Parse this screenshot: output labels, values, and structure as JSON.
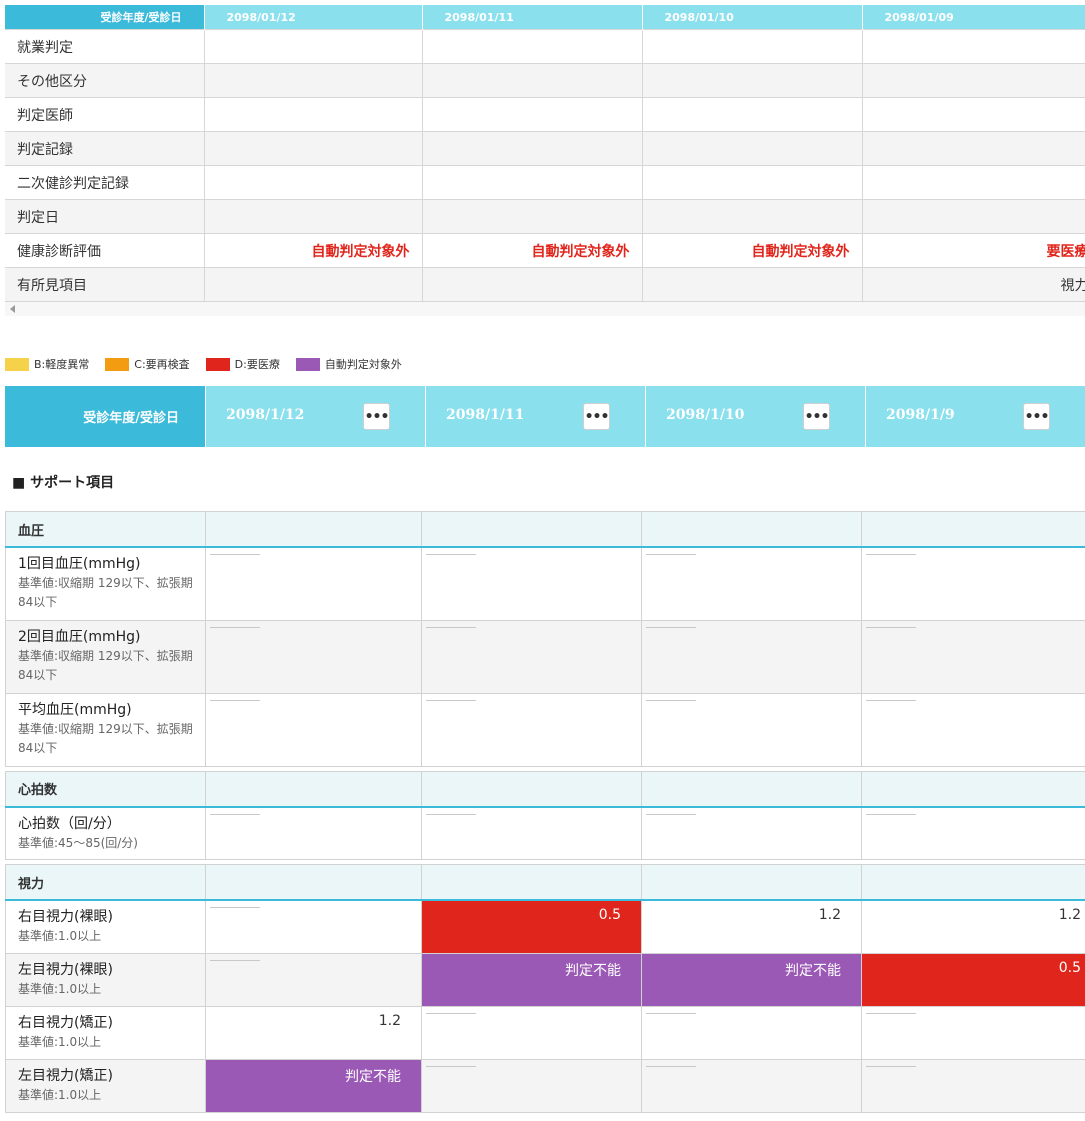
{
  "summary": {
    "header_label": "受診年度/受診日",
    "dates": [
      "2098/01/12",
      "2098/01/11",
      "2098/01/10",
      "2098/01/09"
    ],
    "rows": [
      {
        "label": "就業判定",
        "values": [
          "",
          "",
          "",
          ""
        ]
      },
      {
        "label": "その他区分",
        "values": [
          "",
          "",
          "",
          ""
        ]
      },
      {
        "label": "判定医師",
        "values": [
          "",
          "",
          "",
          ""
        ]
      },
      {
        "label": "判定記録",
        "values": [
          "",
          "",
          "",
          ""
        ]
      },
      {
        "label": "二次健診判定記録",
        "values": [
          "",
          "",
          "",
          ""
        ]
      },
      {
        "label": "判定日",
        "values": [
          "",
          "",
          "",
          ""
        ]
      },
      {
        "label": "健康診断評価",
        "values": [
          "自動判定対象外",
          "自動判定対象外",
          "自動判定対象外",
          "要医療"
        ]
      },
      {
        "label": "有所見項目",
        "values": [
          "",
          "",
          "",
          "視力"
        ]
      }
    ]
  },
  "legend": [
    {
      "label": "B:軽度異常",
      "color": "#f5d24a"
    },
    {
      "label": "C:要再検査",
      "color": "#f39c12"
    },
    {
      "label": "D:要医療",
      "color": "#e0261c"
    },
    {
      "label": "自動判定対象外",
      "color": "#9b59b6"
    }
  ],
  "date_header": {
    "label": "受診年度/受診日",
    "dates": [
      "2098/1/12",
      "2098/1/11",
      "2098/1/10",
      "2098/1/9"
    ],
    "more_label": "•••"
  },
  "section_title": "■ サポート項目",
  "groups": {
    "blood_pressure": {
      "title": "血圧",
      "items": [
        {
          "name": "1回目血圧(mmHg)",
          "ref": "基準値:収縮期 129以下、拡張期 84以下"
        },
        {
          "name": "2回目血圧(mmHg)",
          "ref": "基準値:収縮期 129以下、拡張期 84以下"
        },
        {
          "name": "平均血圧(mmHg)",
          "ref": "基準値:収縮期 129以下、拡張期 84以下"
        }
      ]
    },
    "heart_rate": {
      "title": "心拍数",
      "items": [
        {
          "name": "心拍数（回/分）",
          "ref": "基準値:45〜85(回/分)"
        }
      ]
    },
    "vision": {
      "title": "視力",
      "items": [
        {
          "name": "右目視力(裸眼)",
          "ref": "基準値:1.0以上",
          "values": [
            "",
            "0.5",
            "1.2",
            "1.2"
          ]
        },
        {
          "name": "左目視力(裸眼)",
          "ref": "基準値:1.0以上",
          "values": [
            "",
            "判定不能",
            "判定不能",
            "0.5"
          ]
        },
        {
          "name": "右目視力(矯正)",
          "ref": "基準値:1.0以上",
          "values": [
            "1.2",
            "",
            "",
            ""
          ]
        },
        {
          "name": "左目視力(矯正)",
          "ref": "基準値:1.0以上",
          "values": [
            "判定不能",
            "",
            "",
            ""
          ]
        }
      ]
    }
  },
  "colors": {
    "accent": "#3bbad9",
    "header": "#8be0ee",
    "red": "#e0261c",
    "purple": "#9b59b6"
  }
}
